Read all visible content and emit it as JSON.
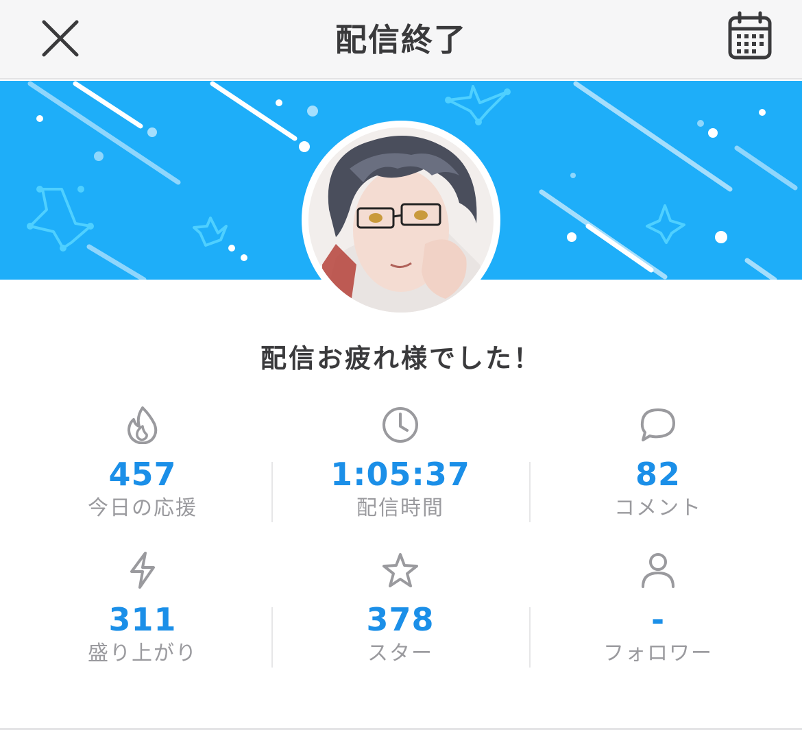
{
  "header": {
    "title": "配信終了",
    "close_icon": "close-icon",
    "calendar_icon": "calendar-icon"
  },
  "banner": {
    "color": "#1eaef9"
  },
  "message": "配信お疲れ様でした！",
  "stats": [
    {
      "icon": "flame-icon",
      "value": "457",
      "label": "今日の応援"
    },
    {
      "icon": "clock-icon",
      "value": "1:05:37",
      "label": "配信時間"
    },
    {
      "icon": "comment-icon",
      "value": "82",
      "label": "コメント"
    },
    {
      "icon": "lightning-icon",
      "value": "311",
      "label": "盛り上がり"
    },
    {
      "icon": "star-icon",
      "value": "378",
      "label": "スター"
    },
    {
      "icon": "person-icon",
      "value": "-",
      "label": "フォロワー"
    }
  ],
  "colors": {
    "accent": "#1b8fe8",
    "label": "#9a9a9e",
    "title": "#3a3a3c"
  }
}
